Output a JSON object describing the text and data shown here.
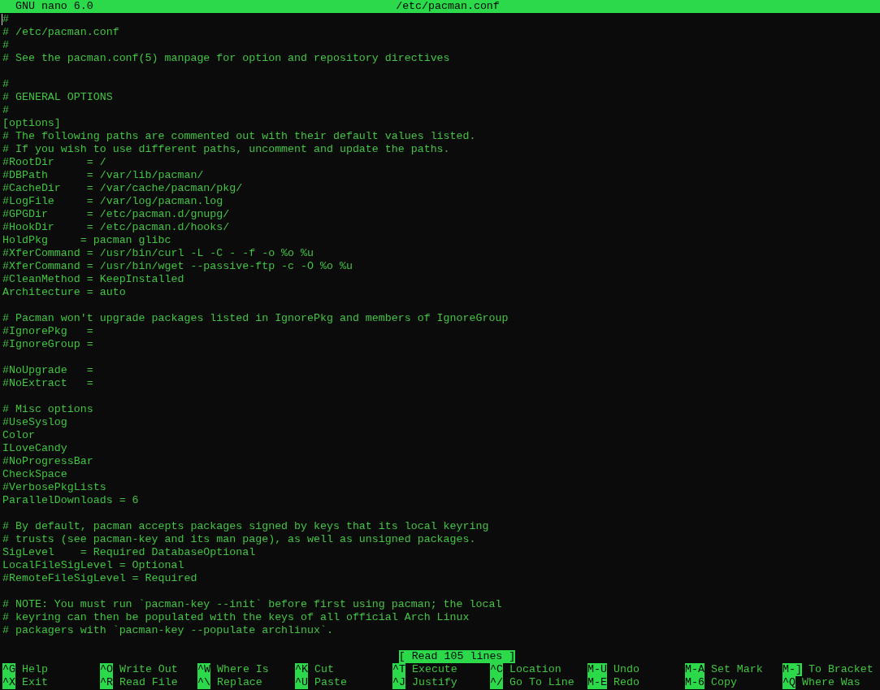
{
  "title_bar": {
    "version": "GNU nano 6.0",
    "file": "/etc/pacman.conf"
  },
  "buffer": {
    "blocks": [
      [
        "#",
        "# /etc/pacman.conf",
        "#",
        "# See the pacman.conf(5) manpage for option and repository directives"
      ],
      [
        "#",
        "# GENERAL OPTIONS",
        "#",
        "[options]",
        "# The following paths are commented out with their default values listed.",
        "# If you wish to use different paths, uncomment and update the paths.",
        "#RootDir     = /",
        "#DBPath      = /var/lib/pacman/",
        "#CacheDir    = /var/cache/pacman/pkg/",
        "#LogFile     = /var/log/pacman.log",
        "#GPGDir      = /etc/pacman.d/gnupg/",
        "#HookDir     = /etc/pacman.d/hooks/",
        "HoldPkg     = pacman glibc",
        "#XferCommand = /usr/bin/curl -L -C - -f -o %o %u",
        "#XferCommand = /usr/bin/wget --passive-ftp -c -O %o %u",
        "#CleanMethod = KeepInstalled",
        "Architecture = auto"
      ],
      [
        "# Pacman won't upgrade packages listed in IgnorePkg and members of IgnoreGroup",
        "#IgnorePkg   =",
        "#IgnoreGroup ="
      ],
      [
        "#NoUpgrade   =",
        "#NoExtract   ="
      ],
      [
        "# Misc options",
        "#UseSyslog",
        "Color",
        "ILoveCandy",
        "#NoProgressBar",
        "CheckSpace",
        "#VerbosePkgLists",
        "ParallelDownloads = 6"
      ],
      [
        "# By default, pacman accepts packages signed by keys that its local keyring",
        "# trusts (see pacman-key and its man page), as well as unsigned packages.",
        "SigLevel    = Required DatabaseOptional",
        "LocalFileSigLevel = Optional",
        "#RemoteFileSigLevel = Required"
      ],
      [
        "# NOTE: You must run `pacman-key --init` before first using pacman; the local",
        "# keyring can then be populated with the keys of all official Arch Linux",
        "# packagers with `pacman-key --populate archlinux`."
      ]
    ]
  },
  "status": "[ Read 105 lines ]",
  "shortcuts": [
    [
      {
        "key": "^G",
        "label": "Help"
      },
      {
        "key": "^O",
        "label": "Write Out"
      },
      {
        "key": "^W",
        "label": "Where Is"
      },
      {
        "key": "^K",
        "label": "Cut"
      },
      {
        "key": "^T",
        "label": "Execute"
      },
      {
        "key": "^C",
        "label": "Location"
      },
      {
        "key": "M-U",
        "label": "Undo"
      },
      {
        "key": "M-A",
        "label": "Set Mark"
      },
      {
        "key": "M-]",
        "label": "To Bracket"
      }
    ],
    [
      {
        "key": "^X",
        "label": "Exit"
      },
      {
        "key": "^R",
        "label": "Read File"
      },
      {
        "key": "^\\",
        "label": "Replace"
      },
      {
        "key": "^U",
        "label": "Paste"
      },
      {
        "key": "^J",
        "label": "Justify"
      },
      {
        "key": "^/",
        "label": "Go To Line"
      },
      {
        "key": "M-E",
        "label": "Redo"
      },
      {
        "key": "M-6",
        "label": "Copy"
      },
      {
        "key": "^Q",
        "label": "Where Was"
      }
    ]
  ]
}
